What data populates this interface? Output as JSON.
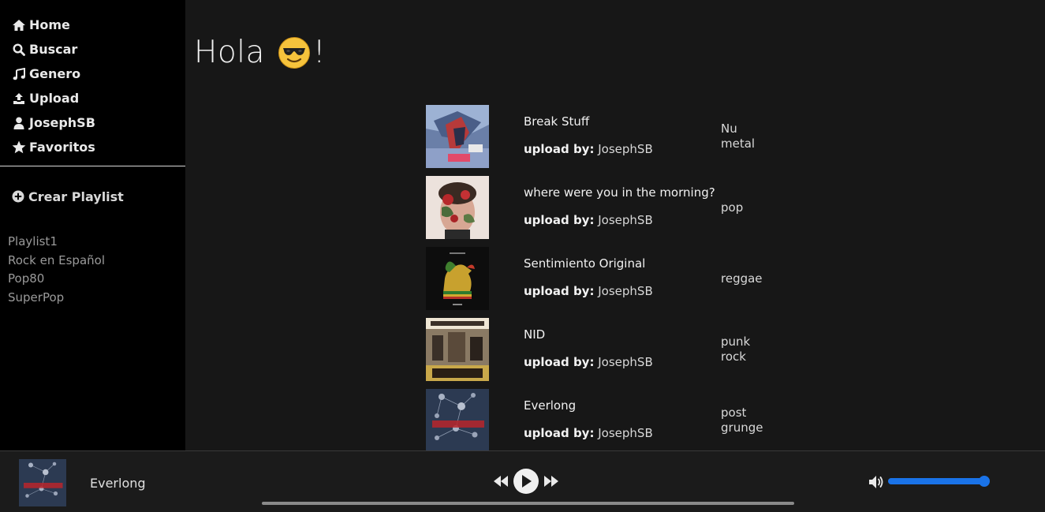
{
  "sidebar": {
    "nav": [
      {
        "label": "Home",
        "icon": "home-icon"
      },
      {
        "label": "Buscar",
        "icon": "search-icon"
      },
      {
        "label": "Genero",
        "icon": "music-note-icon"
      },
      {
        "label": "Upload",
        "icon": "upload-icon"
      },
      {
        "label": "JosephSB",
        "icon": "user-icon"
      },
      {
        "label": "Favoritos",
        "icon": "star-icon"
      }
    ],
    "create_playlist": {
      "label": "Crear Playlist",
      "icon": "plus-circle-icon"
    },
    "playlists": [
      "Playlist1",
      "Rock en Español",
      "Pop80",
      "SuperPop"
    ]
  },
  "main": {
    "greeting": "Hola",
    "greeting_suffix": "!",
    "greeting_emoji": "sunglasses-emoji-icon",
    "upload_label": "upload by:",
    "songs": [
      {
        "title": "Break Stuff",
        "uploader": "JosephSB",
        "genre": "Nu metal"
      },
      {
        "title": "where were you in the morning?",
        "uploader": "JosephSB",
        "genre": "pop"
      },
      {
        "title": "Sentimiento Original",
        "uploader": "JosephSB",
        "genre": "reggae"
      },
      {
        "title": "NID",
        "uploader": "JosephSB",
        "genre": "punk rock"
      },
      {
        "title": "Everlong",
        "uploader": "JosephSB",
        "genre": "post grunge"
      }
    ]
  },
  "player": {
    "now_playing": "Everlong",
    "progress": 0,
    "volume": 1.0,
    "icons": [
      "rewind-icon",
      "play-icon",
      "fast-forward-icon",
      "volume-icon"
    ]
  },
  "colors": {
    "background": "#171717",
    "sidebar": "#000000",
    "accent": "#1a73e8"
  }
}
